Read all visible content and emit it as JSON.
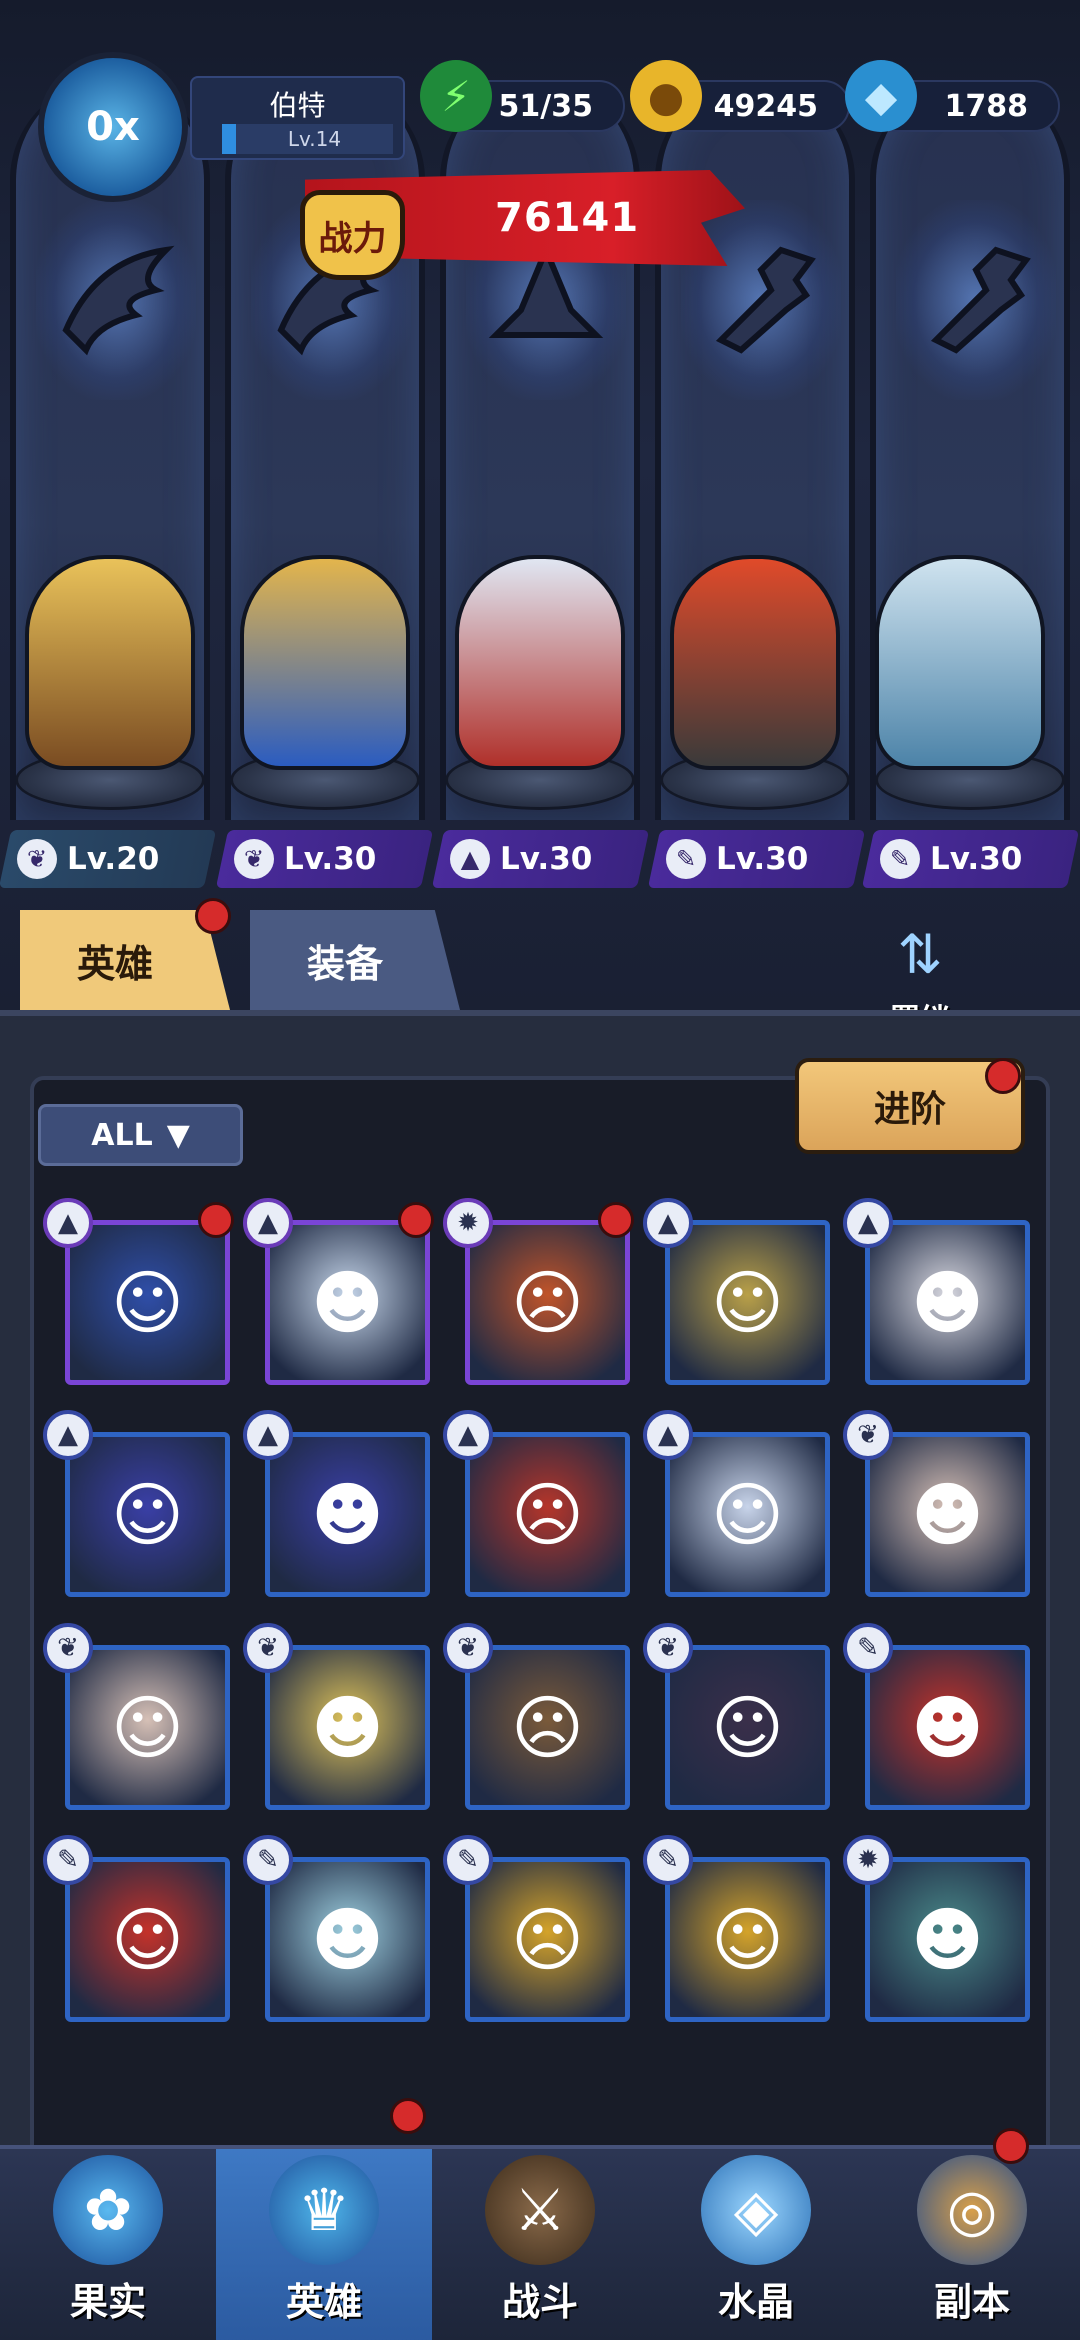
{
  "player": {
    "name": "伯特",
    "level": "Lv.14",
    "avatar_label": "0x"
  },
  "resources": {
    "stamina": "51/35",
    "gold": "49245",
    "diamonds": "1788"
  },
  "power": {
    "label": "战力",
    "value": "76141"
  },
  "lineup": [
    {
      "class_icon": "wing-icon",
      "level": "Lv.20",
      "color": "#c9a23a"
    },
    {
      "class_icon": "wing-icon",
      "level": "Lv.30",
      "color": "#d8a34a"
    },
    {
      "class_icon": "hat-icon",
      "level": "Lv.30",
      "color": "#b53a2a"
    },
    {
      "class_icon": "wrench-icon",
      "level": "Lv.30",
      "color": "#d2412a"
    },
    {
      "class_icon": "wrench-icon",
      "level": "Lv.30",
      "color": "#6fa9c6"
    }
  ],
  "tabs": {
    "heroes": "英雄",
    "equipment": "装备"
  },
  "bond_label": "羁绊",
  "filter_label": "ALL",
  "advance_label": "进阶",
  "hero_cards": [
    {
      "class": "hat",
      "frame": "purple",
      "badge": true
    },
    {
      "class": "hat",
      "frame": "purple",
      "badge": true
    },
    {
      "class": "claw",
      "frame": "purple",
      "badge": true
    },
    {
      "class": "hat",
      "frame": "blue",
      "badge": false
    },
    {
      "class": "hat",
      "frame": "blue",
      "badge": false
    },
    {
      "class": "hat",
      "frame": "blue",
      "badge": false
    },
    {
      "class": "hat",
      "frame": "blue",
      "badge": false
    },
    {
      "class": "hat",
      "frame": "blue",
      "badge": false
    },
    {
      "class": "hat",
      "frame": "blue",
      "badge": false
    },
    {
      "class": "wing",
      "frame": "blue",
      "badge": false
    },
    {
      "class": "wing",
      "frame": "blue",
      "badge": false
    },
    {
      "class": "wing",
      "frame": "blue",
      "badge": false
    },
    {
      "class": "wing",
      "frame": "blue",
      "badge": false
    },
    {
      "class": "wing",
      "frame": "blue",
      "badge": false
    },
    {
      "class": "wrench",
      "frame": "blue",
      "badge": false
    },
    {
      "class": "wrench",
      "frame": "blue",
      "badge": false
    },
    {
      "class": "wrench",
      "frame": "blue",
      "badge": false
    },
    {
      "class": "wrench",
      "frame": "blue",
      "badge": false
    },
    {
      "class": "wrench",
      "frame": "blue",
      "badge": false
    },
    {
      "class": "claw",
      "frame": "blue",
      "badge": false
    }
  ],
  "nav": [
    {
      "label": "果实",
      "icon": "fruit-icon"
    },
    {
      "label": "英雄",
      "icon": "hero-icon",
      "active": true
    },
    {
      "label": "战斗",
      "icon": "battle-icon"
    },
    {
      "label": "水晶",
      "icon": "crystal-icon"
    },
    {
      "label": "副本",
      "icon": "dungeon-icon"
    }
  ],
  "colors": {
    "accent_gold": "#f0c97a",
    "power_red": "#d81f28",
    "frame_blue": "#2e64c4",
    "frame_purple": "#7a45d6",
    "badge_red": "#d62b2b"
  }
}
